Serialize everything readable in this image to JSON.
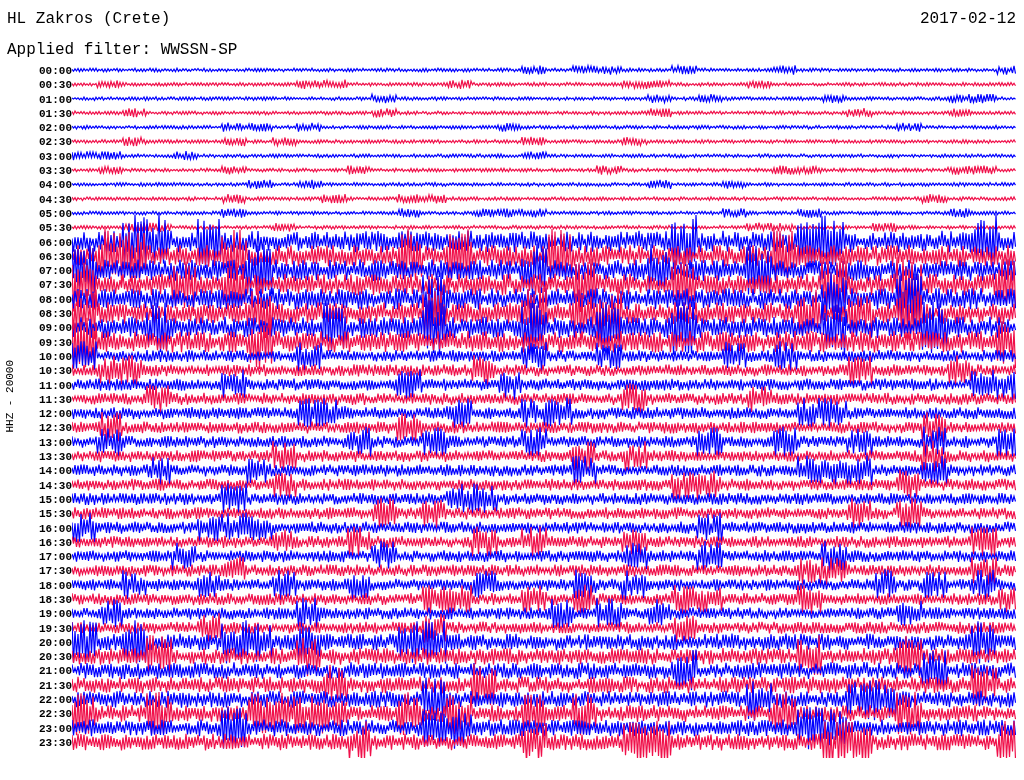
{
  "header": {
    "station": "HL Zakros (Crete)",
    "date": "2017-02-12",
    "filter": "Applied filter: WWSSN-SP"
  },
  "axis_label": "HHZ - 20000",
  "traces": [
    {
      "time": "00:00",
      "color": "#0000ff"
    },
    {
      "time": "00:30",
      "color": "#f0104a"
    },
    {
      "time": "01:00",
      "color": "#0000ff"
    },
    {
      "time": "01:30",
      "color": "#f0104a"
    },
    {
      "time": "02:00",
      "color": "#0000ff"
    },
    {
      "time": "02:30",
      "color": "#f0104a"
    },
    {
      "time": "03:00",
      "color": "#0000ff"
    },
    {
      "time": "03:30",
      "color": "#f0104a"
    },
    {
      "time": "04:00",
      "color": "#0000ff"
    },
    {
      "time": "04:30",
      "color": "#f0104a"
    },
    {
      "time": "05:00",
      "color": "#0000ff"
    },
    {
      "time": "05:30",
      "color": "#f0104a"
    },
    {
      "time": "06:00",
      "color": "#0000ff"
    },
    {
      "time": "06:30",
      "color": "#f0104a"
    },
    {
      "time": "07:00",
      "color": "#0000ff"
    },
    {
      "time": "07:30",
      "color": "#f0104a"
    },
    {
      "time": "08:00",
      "color": "#0000ff"
    },
    {
      "time": "08:30",
      "color": "#f0104a"
    },
    {
      "time": "09:00",
      "color": "#0000ff"
    },
    {
      "time": "09:30",
      "color": "#f0104a"
    },
    {
      "time": "10:00",
      "color": "#0000ff"
    },
    {
      "time": "10:30",
      "color": "#f0104a"
    },
    {
      "time": "11:00",
      "color": "#0000ff"
    },
    {
      "time": "11:30",
      "color": "#f0104a"
    },
    {
      "time": "12:00",
      "color": "#0000ff"
    },
    {
      "time": "12:30",
      "color": "#f0104a"
    },
    {
      "time": "13:00",
      "color": "#0000ff"
    },
    {
      "time": "13:30",
      "color": "#f0104a"
    },
    {
      "time": "14:00",
      "color": "#0000ff"
    },
    {
      "time": "14:30",
      "color": "#f0104a"
    },
    {
      "time": "15:00",
      "color": "#0000ff"
    },
    {
      "time": "15:30",
      "color": "#f0104a"
    },
    {
      "time": "16:00",
      "color": "#0000ff"
    },
    {
      "time": "16:30",
      "color": "#f0104a"
    },
    {
      "time": "17:00",
      "color": "#0000ff"
    },
    {
      "time": "17:30",
      "color": "#f0104a"
    },
    {
      "time": "18:00",
      "color": "#0000ff"
    },
    {
      "time": "18:30",
      "color": "#f0104a"
    },
    {
      "time": "19:00",
      "color": "#0000ff"
    },
    {
      "time": "19:30",
      "color": "#f0104a"
    },
    {
      "time": "20:00",
      "color": "#0000ff"
    },
    {
      "time": "20:30",
      "color": "#f0104a"
    },
    {
      "time": "21:00",
      "color": "#0000ff"
    },
    {
      "time": "21:30",
      "color": "#f0104a"
    },
    {
      "time": "22:00",
      "color": "#0000ff"
    },
    {
      "time": "22:30",
      "color": "#f0104a"
    },
    {
      "time": "23:00",
      "color": "#0000ff"
    },
    {
      "time": "23:30",
      "color": "#f0104a"
    }
  ]
}
